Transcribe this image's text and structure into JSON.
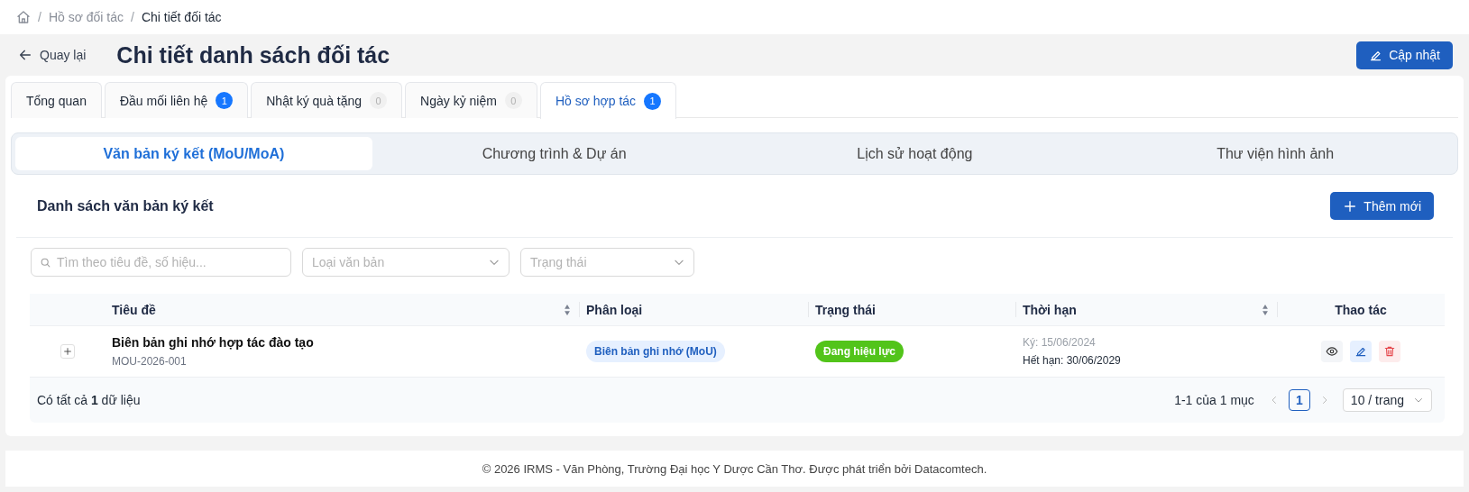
{
  "breadcrumb": [
    {
      "separator": "/",
      "label": "Hồ sơ đối tác",
      "current": false
    },
    {
      "separator": "/",
      "label": "Chi tiết đối tác",
      "current": true
    }
  ],
  "header": {
    "back": "Quay lại",
    "title": "Chi tiết danh sách đối tác",
    "action": "Cập nhật"
  },
  "tabs": [
    {
      "label": "Tổng quan",
      "selected": false
    },
    {
      "label": "Đầu mối liên hệ",
      "count": "1",
      "highlighted": true,
      "selected": false
    },
    {
      "label": "Nhật ký quà tặng",
      "count": "0",
      "highlighted": false,
      "selected": false
    },
    {
      "label": "Ngày kỷ niệm",
      "count": "0",
      "highlighted": false,
      "selected": false
    },
    {
      "label": "Hồ sơ hợp tác",
      "count": "1",
      "highlighted": true,
      "selected": true
    }
  ],
  "segments": [
    {
      "label": "Văn bản ký kết (MoU/MoA)",
      "selected": true
    },
    {
      "label": "Chương trình & Dự án",
      "selected": false
    },
    {
      "label": "Lịch sử hoạt động",
      "selected": false
    },
    {
      "label": "Thư viện hình ảnh",
      "selected": false
    }
  ],
  "section": {
    "title": "Danh sách văn bản ký kết",
    "add_button": "Thêm mới"
  },
  "filters": [
    {
      "kind": "search",
      "placeholder": "Tìm theo tiêu đề, số hiệu..."
    },
    {
      "kind": "select",
      "placeholder": "Loại văn bản"
    },
    {
      "kind": "select",
      "placeholder": "Trạng thái"
    }
  ],
  "table": {
    "columns": [
      {
        "label": "Tiêu đề",
        "sortable": true
      },
      {
        "label": "Phân loại",
        "sortable": false
      },
      {
        "label": "Trạng thái",
        "sortable": false
      },
      {
        "label": "Thời hạn",
        "sortable": true
      },
      {
        "label": "Thao tác",
        "sortable": false
      }
    ],
    "rows": [
      {
        "expanded": false,
        "title": "Biên bản ghi nhớ hợp tác đào tạo",
        "code": "MOU-2026-001",
        "type": "Biên bản ghi nhớ (MoU)",
        "status": {
          "label": "Đang hiệu lực",
          "color": "#52c41a"
        },
        "signed": "Ký: 15/06/2024",
        "expires": "Hết hạn: 30/06/2029"
      }
    ]
  },
  "summary": "Có tất cả **1** dữ liệu",
  "pagination": {
    "range": "1-1 của 1 mục",
    "pages": [
      {
        "label": "1",
        "selected": true
      }
    ],
    "page_size": "10 / trang"
  },
  "footer": "© 2026 IRMS - Văn Phòng, Trường Đại học Y Dược Cần Thơ. Được phát triển bởi Datacomtech."
}
